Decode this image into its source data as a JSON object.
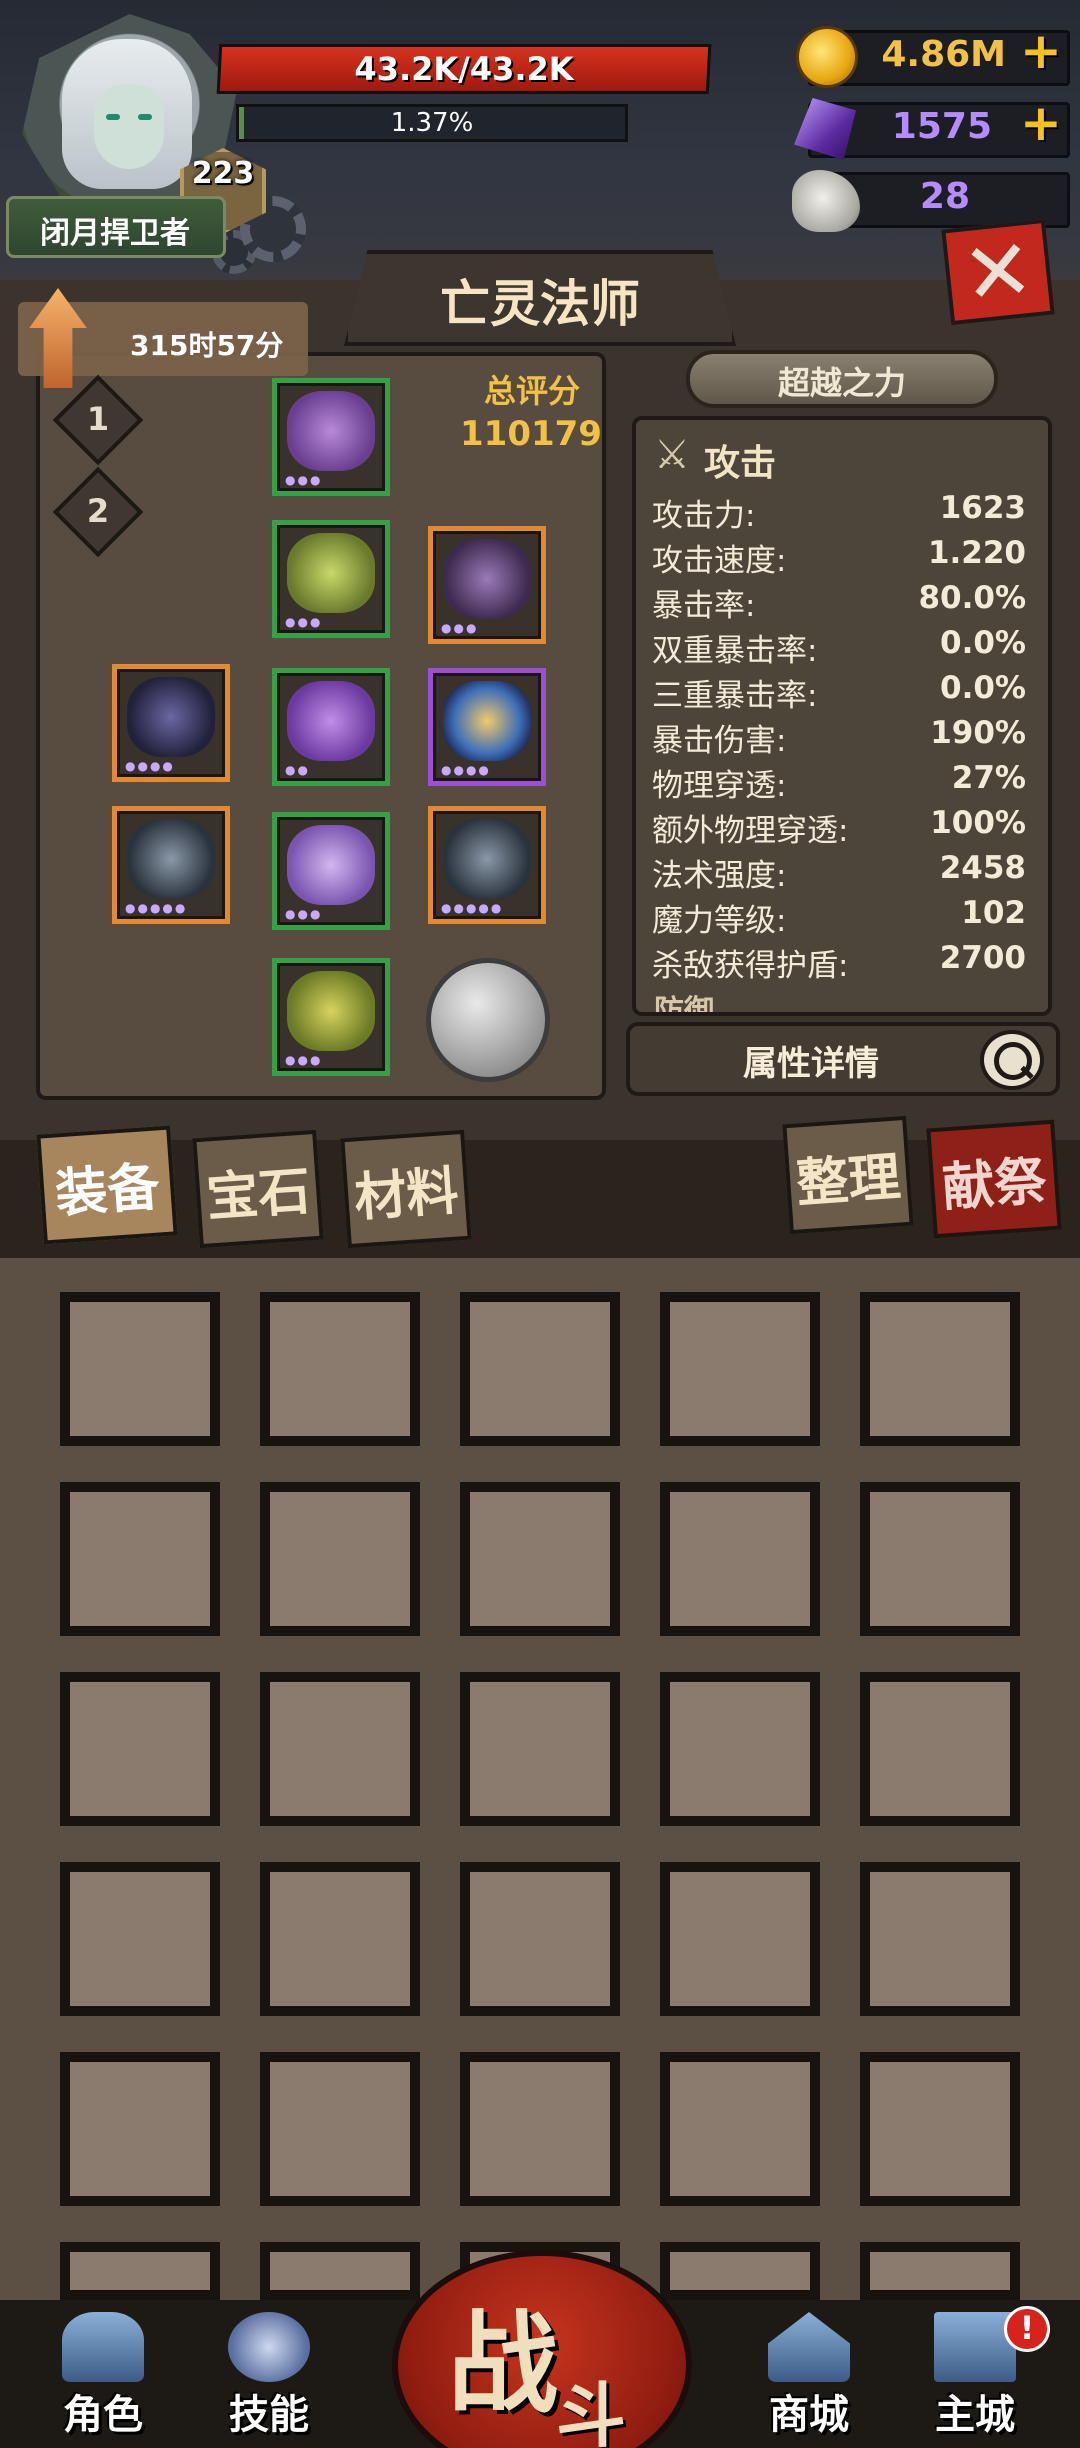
{
  "player": {
    "title": "闭月捍卫者",
    "level": "223",
    "hp_text": "43.2K/43.2K",
    "hp_fraction": 1.0,
    "exp_text": "1.37%",
    "exp_fraction": 0.0137
  },
  "resources": {
    "gold": "4.86M",
    "gems": "1575",
    "skulls": "28",
    "plus_symbol": "+"
  },
  "close_symbol": "✕",
  "character": {
    "class_name": "亡灵法师",
    "timer": "315时57分",
    "presets": [
      "1",
      "2"
    ],
    "score_label": "总评分",
    "score_value": "110179"
  },
  "transcend_label": "超越之力",
  "stats": {
    "section_title": "攻击",
    "rows": [
      {
        "label": "攻击力:",
        "value": "1623"
      },
      {
        "label": "攻击速度:",
        "value": "1.220"
      },
      {
        "label": "暴击率:",
        "value": "80.0%"
      },
      {
        "label": "双重暴击率:",
        "value": "0.0%"
      },
      {
        "label": "三重暴击率:",
        "value": "0.0%"
      },
      {
        "label": "暴击伤害:",
        "value": "190%"
      },
      {
        "label": "物理穿透:",
        "value": "27%"
      },
      {
        "label": "额外物理穿透:",
        "value": "100%"
      },
      {
        "label": "法术强度:",
        "value": "2458"
      },
      {
        "label": "魔力等级:",
        "value": "102"
      },
      {
        "label": "杀敌获得护盾:",
        "value": "2700"
      }
    ],
    "next_section_peek": "防御",
    "detail_button": "属性详情"
  },
  "tabs": {
    "equipment": "装备",
    "gems": "宝石",
    "materials": "材料",
    "sort": "整理",
    "sacrifice": "献祭"
  },
  "nav": {
    "character": "角色",
    "skills": "技能",
    "fight_1": "战",
    "fight_2": "斗",
    "shop": "商城",
    "main_city": "主城",
    "notification": "!"
  },
  "colors": {
    "hp": "#c4281a",
    "gold": "#f1c244",
    "gem_text": "#b58cff",
    "rarity_green": "#33a247",
    "rarity_orange": "#e58a2c",
    "rarity_purple": "#9c4fd4"
  }
}
